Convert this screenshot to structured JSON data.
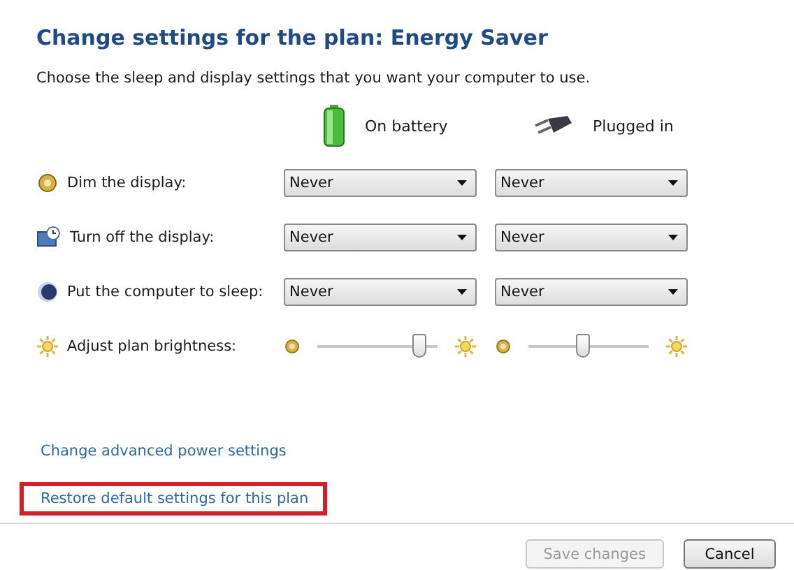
{
  "title": "Change settings for the plan: Energy Saver",
  "subtitle": "Choose the sleep and display settings that you want your computer to use.",
  "columns": [
    {
      "label": "On battery",
      "kind": "battery"
    },
    {
      "label": "Plugged in",
      "kind": "plug"
    }
  ],
  "settings": [
    {
      "kind": "dropdown",
      "label": "Dim the display:",
      "values": [
        "Never",
        "Never"
      ]
    },
    {
      "kind": "dropdown",
      "label": "Turn off the display:",
      "values": [
        "Never",
        "Never"
      ]
    },
    {
      "kind": "dropdown",
      "label": "Put the computer to sleep:",
      "values": [
        "Never",
        "Never"
      ]
    },
    {
      "kind": "slider",
      "label": "Adjust plan brightness:",
      "sliders": [
        {
          "level": 0.85
        },
        {
          "level": 0.45
        }
      ]
    }
  ],
  "links": [
    {
      "label": "Change advanced power settings",
      "highlighted": false
    },
    {
      "label": "Restore default settings for this plan",
      "highlighted": true
    }
  ],
  "buttons": [
    {
      "label": "Save changes",
      "disabled": true
    },
    {
      "label": "Cancel",
      "disabled": false
    }
  ]
}
